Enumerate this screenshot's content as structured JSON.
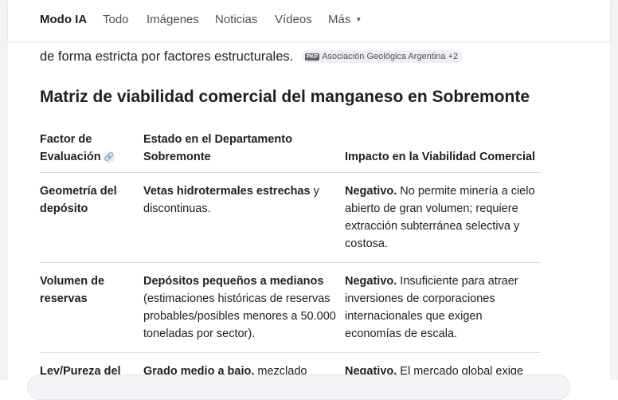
{
  "nav": {
    "items": [
      {
        "label": "Modo IA",
        "active": true
      },
      {
        "label": "Todo",
        "active": false
      },
      {
        "label": "Imágenes",
        "active": false
      },
      {
        "label": "Noticias",
        "active": false
      },
      {
        "label": "Vídeos",
        "active": false
      },
      {
        "label": "Más",
        "active": false
      }
    ]
  },
  "answer": {
    "cut_line": "de forma estricta por factores estructurales.",
    "source_chip": {
      "logo": "PKP",
      "label": "Asociación Geológica Argentina +2"
    },
    "section_title": "Matriz de viabilidad comercial del manganeso en Sobremonte"
  },
  "table": {
    "headers": {
      "col1_line1": "Factor de",
      "col1_line2": "Evaluación",
      "col2_line1": "Estado en el Departamento",
      "col2_line2": "Sobremonte",
      "col3": "Impacto en la Viabilidad Comercial"
    },
    "link_icon": "link-icon",
    "rows": [
      {
        "factor": "Geometría del depósito",
        "estado_strong": "Vetas hidrotermales estrechas",
        "estado_rest": " y discontinuas.",
        "impacto_strong": "Negativo.",
        "impacto_rest": " No permite minería a cielo abierto de gran volumen; requiere extracción subterránea selectiva y costosa."
      },
      {
        "factor": "Volumen de reservas",
        "estado_strong": "Depósitos pequeños a medianos",
        "estado_rest": " (estimaciones históricas de reservas probables/posibles menores a 50.000 toneladas por sector).",
        "impacto_strong": "Negativo.",
        "impacto_rest": " Insuficiente para atraer inversiones de corporaciones internacionales que exigen economías de escala."
      },
      {
        "factor": "Ley/Pureza del",
        "estado_strong": "Grado medio a bajo,",
        "estado_rest": " mezclado",
        "impacto_strong": "Negativo.",
        "impacto_rest": " El mercado global exige"
      }
    ]
  },
  "colors": {
    "text": "#1f1f1f",
    "nav_inactive": "#4d5156",
    "divider": "#dadce0"
  }
}
